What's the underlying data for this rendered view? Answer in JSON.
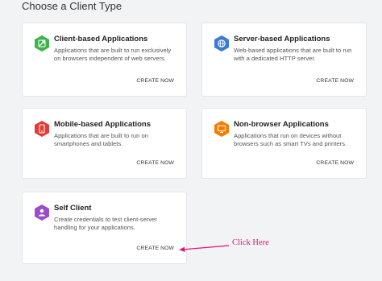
{
  "page": {
    "title": "Choose a Client Type"
  },
  "cards": [
    {
      "title": "Client-based Applications",
      "description": "Applications that are built to run exclusively on browsers independent of web servers.",
      "action": "CREATE NOW",
      "icon": "client-app-icon",
      "color": "#3bb54a"
    },
    {
      "title": "Server-based Applications",
      "description": "Web-based applications that are built to run with a dedicated HTTP server.",
      "action": "CREATE NOW",
      "icon": "server-app-icon",
      "color": "#3a7bd5"
    },
    {
      "title": "Mobile-based Applications",
      "description": "Applications that are built to run on smartphones and tablets.",
      "action": "CREATE NOW",
      "icon": "mobile-app-icon",
      "color": "#e53935"
    },
    {
      "title": "Non-browser Applications",
      "description": "Applications that run on devices without browsers such as smart TVs and printers.",
      "action": "CREATE NOW",
      "icon": "non-browser-app-icon",
      "color": "#f57c00"
    },
    {
      "title": "Self Client",
      "description": "Create credentials to test client-server handling for your applications.",
      "action": "CREATE NOW",
      "icon": "self-client-icon",
      "color": "#9c4dcc"
    }
  ],
  "annotation": {
    "text": "Click Here",
    "color": "#e0147a"
  }
}
